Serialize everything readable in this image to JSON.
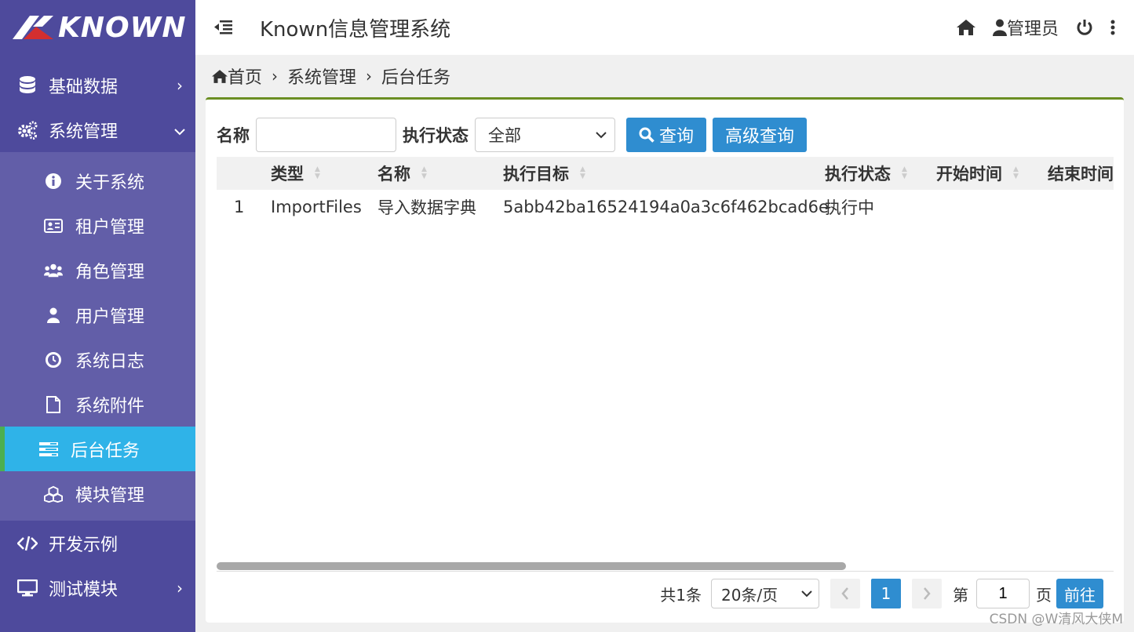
{
  "app": {
    "logo_text": "KNOWN",
    "title": "Known信息管理系统"
  },
  "header": {
    "user_label": "管理员"
  },
  "sidebar": {
    "groups": [
      {
        "label": "基础数据",
        "icon": "database-icon",
        "chevron": "›"
      },
      {
        "label": "系统管理",
        "icon": "cogs-icon",
        "chevron": "⌄"
      }
    ],
    "sub_items": [
      {
        "label": "关于系统",
        "icon": "info-icon"
      },
      {
        "label": "租户管理",
        "icon": "id-card-icon"
      },
      {
        "label": "角色管理",
        "icon": "users-icon"
      },
      {
        "label": "用户管理",
        "icon": "user-icon"
      },
      {
        "label": "系统日志",
        "icon": "clock-icon"
      },
      {
        "label": "系统附件",
        "icon": "file-icon"
      },
      {
        "label": "后台任务",
        "icon": "tasks-icon",
        "active": true
      },
      {
        "label": "模块管理",
        "icon": "cubes-icon"
      }
    ],
    "bottom": [
      {
        "label": "开发示例",
        "icon": "code-icon"
      },
      {
        "label": "测试模块",
        "icon": "desktop-icon",
        "chevron": "›"
      }
    ]
  },
  "breadcrumb": [
    "首页",
    "系统管理",
    "后台任务"
  ],
  "search": {
    "name_label": "名称",
    "name_value": "",
    "status_label": "执行状态",
    "status_value": "全部",
    "query_button": "查询",
    "advanced_button": "高级查询"
  },
  "table": {
    "columns": [
      "类型",
      "名称",
      "执行目标",
      "执行状态",
      "开始时间",
      "结束时间"
    ],
    "rows": [
      {
        "index": "1",
        "type": "ImportFiles",
        "name": "导入数据字典",
        "target": "5abb42ba16524194a0a3c6f462bcad6e",
        "status": "执行中",
        "start": "",
        "end": ""
      }
    ]
  },
  "pager": {
    "total_text": "共1条",
    "page_size": "20条/页",
    "current_page": "1",
    "goto_prefix": "第",
    "goto_value": "1",
    "goto_suffix": "页",
    "go_button": "前往"
  },
  "watermark": "CSDN @W清风大侠M",
  "colors": {
    "sidebar_bg": "#4e4a9c",
    "submenu_bg": "#625ea8",
    "active_bg": "#2fb3e8",
    "primary": "#2f8dd0",
    "panel_accent": "#6b8e23"
  }
}
